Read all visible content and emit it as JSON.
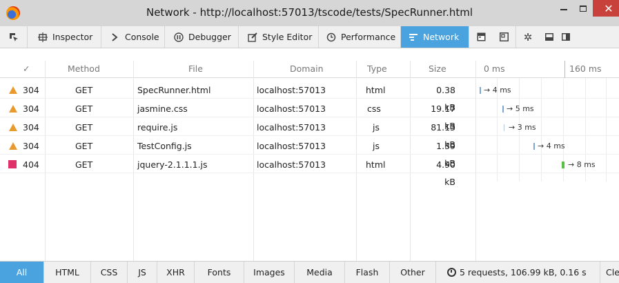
{
  "window": {
    "title": "Network - http://localhost:57013/tscode/tests/SpecRunner.html",
    "close_glyph": "✕"
  },
  "toolbar": {
    "tabs": [
      {
        "label": "",
        "icon": "pick-element-icon"
      },
      {
        "label": "Inspector",
        "icon": "inspector-icon"
      },
      {
        "label": "Console",
        "icon": "console-icon"
      },
      {
        "label": "Debugger",
        "icon": "debugger-icon"
      },
      {
        "label": "Style Editor",
        "icon": "style-editor-icon"
      },
      {
        "label": "Performance",
        "icon": "performance-icon"
      },
      {
        "label": "Network",
        "icon": "network-icon",
        "active": true
      },
      {
        "label": "",
        "icon": "scratchpad-icon"
      },
      {
        "label": "",
        "icon": "responsive-icon"
      },
      {
        "label": "",
        "icon": "settings-icon"
      },
      {
        "label": "",
        "icon": "dock-bottom-icon"
      },
      {
        "label": "",
        "icon": "dock-side-icon"
      }
    ]
  },
  "table": {
    "headers": {
      "check": "✓",
      "method": "Method",
      "file": "File",
      "domain": "Domain",
      "type": "Type",
      "size": "Size",
      "t0": "0 ms",
      "t1": "160 ms"
    },
    "rows": [
      {
        "status": "304",
        "method": "GET",
        "file": "SpecRunner.html",
        "domain": "localhost:57013",
        "type": "html",
        "size": "0.38 kB",
        "timing": "→ 4 ms",
        "status_color": "#e89a2e"
      },
      {
        "status": "304",
        "method": "GET",
        "file": "jasmine.css",
        "domain": "localhost:57013",
        "type": "css",
        "size": "19.17 kB",
        "timing": "→ 5 ms",
        "status_color": "#e89a2e"
      },
      {
        "status": "304",
        "method": "GET",
        "file": "require.js",
        "domain": "localhost:57013",
        "type": "js",
        "size": "81.13 kB",
        "timing": "→ 3 ms",
        "status_color": "#e89a2e"
      },
      {
        "status": "304",
        "method": "GET",
        "file": "TestConfig.js",
        "domain": "localhost:57013",
        "type": "js",
        "size": "1.39 kB",
        "timing": "→ 4 ms",
        "status_color": "#e89a2e"
      },
      {
        "status": "404",
        "method": "GET",
        "file": "jquery-2.1.1.1.js",
        "domain": "localhost:57013",
        "type": "html",
        "size": "4.90 kB",
        "timing": "→ 8 ms",
        "status_color": "#e0306a"
      }
    ]
  },
  "filters": {
    "items": [
      "All",
      "HTML",
      "CSS",
      "JS",
      "XHR",
      "Fonts",
      "Images",
      "Media",
      "Flash",
      "Other"
    ],
    "active": "All",
    "summary": "5 requests, 106.99 kB, 0.16 s",
    "clear_label": "Cle"
  },
  "colors": {
    "accent": "#4aa3df",
    "warning": "#e89a2e",
    "error": "#e0306a",
    "close": "#c8413a"
  }
}
